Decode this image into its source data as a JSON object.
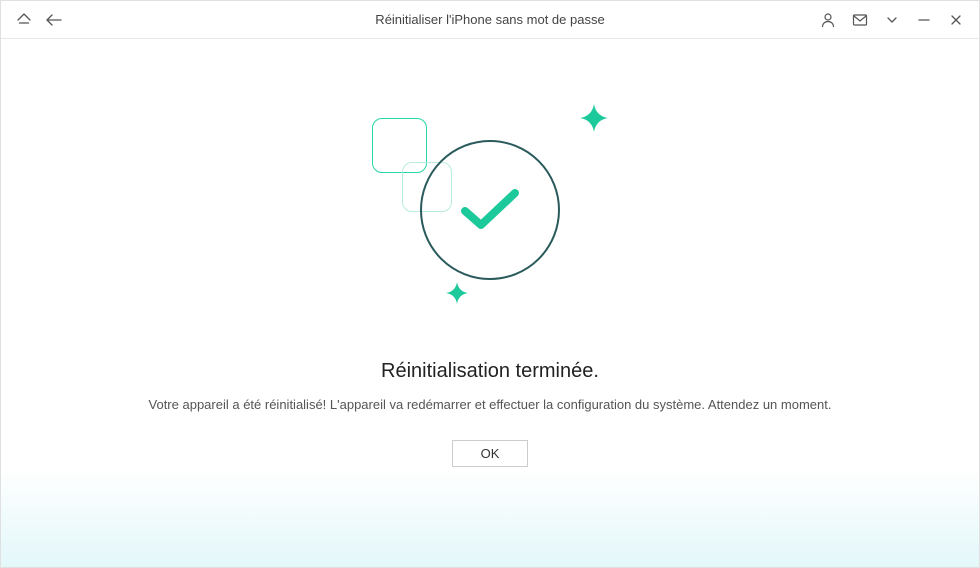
{
  "titlebar": {
    "title": "Réinitialiser l'iPhone sans mot de passe"
  },
  "content": {
    "heading": "Réinitialisation terminée.",
    "subtext": "Votre appareil a été réinitialisé! L'appareil va redémarrer et effectuer la configuration du système. Attendez un moment.",
    "ok_label": "OK"
  }
}
